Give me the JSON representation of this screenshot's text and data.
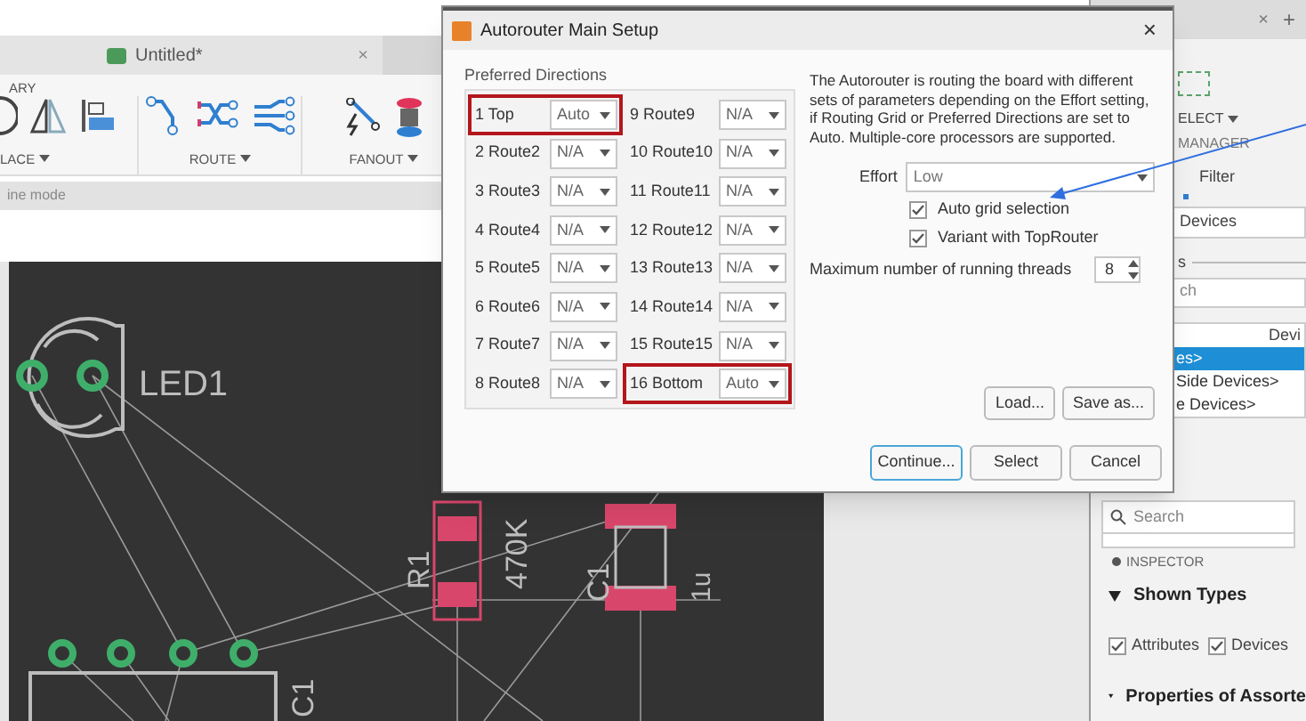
{
  "document_tab": {
    "title": "Untitled*",
    "close": "×"
  },
  "ribbon": {
    "top_label": "ARY",
    "groups": [
      {
        "label": "LACE",
        "kind": "place"
      },
      {
        "label": "ROUTE",
        "kind": "route"
      },
      {
        "label": "FANOUT",
        "kind": "fanout"
      }
    ]
  },
  "mode_bar": "ine mode",
  "canvas": {
    "labels": [
      {
        "text": "LED1",
        "kind": "led"
      },
      {
        "text": "R1",
        "kind": "r1"
      },
      {
        "text": "470K",
        "kind": "r1value"
      },
      {
        "text": "C1",
        "kind": "c1"
      },
      {
        "text": "1u",
        "kind": "c1value"
      },
      {
        "text": "C1",
        "kind": "lower"
      }
    ]
  },
  "dialog": {
    "title": "Autorouter Main Setup",
    "close": "×",
    "group_title": "Preferred Directions",
    "layers": [
      {
        "number": "1",
        "name": "Top",
        "direction": "Auto",
        "highlighted": true
      },
      {
        "number": "2",
        "name": "Route2",
        "direction": "N/A",
        "highlighted": false
      },
      {
        "number": "3",
        "name": "Route3",
        "direction": "N/A",
        "highlighted": false
      },
      {
        "number": "4",
        "name": "Route4",
        "direction": "N/A",
        "highlighted": false
      },
      {
        "number": "5",
        "name": "Route5",
        "direction": "N/A",
        "highlighted": false
      },
      {
        "number": "6",
        "name": "Route6",
        "direction": "N/A",
        "highlighted": false
      },
      {
        "number": "7",
        "name": "Route7",
        "direction": "N/A",
        "highlighted": false
      },
      {
        "number": "8",
        "name": "Route8",
        "direction": "N/A",
        "highlighted": false
      },
      {
        "number": "9",
        "name": "Route9",
        "direction": "N/A",
        "highlighted": false
      },
      {
        "number": "10",
        "name": "Route10",
        "direction": "N/A",
        "highlighted": false
      },
      {
        "number": "11",
        "name": "Route11",
        "direction": "N/A",
        "highlighted": false
      },
      {
        "number": "12",
        "name": "Route12",
        "direction": "N/A",
        "highlighted": false
      },
      {
        "number": "13",
        "name": "Route13",
        "direction": "N/A",
        "highlighted": false
      },
      {
        "number": "14",
        "name": "Route14",
        "direction": "N/A",
        "highlighted": false
      },
      {
        "number": "15",
        "name": "Route15",
        "direction": "N/A",
        "highlighted": false
      },
      {
        "number": "16",
        "name": "Bottom",
        "direction": "Auto",
        "highlighted": true
      }
    ],
    "description": "The Autorouter is routing the board with different sets of parameters depending on the Effort setting, if Routing Grid or Preferred Directions are set to Auto. Multiple-core processors are supported.",
    "effort_label": "Effort",
    "effort_value": "Low",
    "options": [
      {
        "label": "Auto grid selection",
        "checked": true
      },
      {
        "label": "Variant with TopRouter",
        "checked": true
      }
    ],
    "threads_label": "Maximum number of running threads",
    "threads_value": "8",
    "file_buttons": [
      "Load...",
      "Save as..."
    ],
    "footer_buttons": [
      {
        "label": "Continue...",
        "focused": true
      },
      {
        "label": "Select",
        "focused": false
      },
      {
        "label": "Cancel",
        "focused": false
      }
    ]
  },
  "right_panel": {
    "tab_close": "×",
    "tab_add": "+",
    "select_label": "ELECT",
    "manager_title": "MANAGER",
    "filter_label": "Filter",
    "devices_field": "Devices",
    "section_label": "s",
    "search_field": "ch",
    "list_header": "Devi",
    "list_items": [
      {
        "label": "es>",
        "selected": true
      },
      {
        "label": "Side Devices>",
        "selected": false
      },
      {
        "label": "e Devices>",
        "selected": false
      }
    ],
    "search_placeholder": "Search",
    "inspector_title": "INSPECTOR",
    "shown_types": {
      "title": "Shown Types",
      "expanded": true,
      "options": [
        {
          "label": "Attributes",
          "checked": true
        },
        {
          "label": "Devices",
          "checked": true
        }
      ]
    },
    "properties_title": "Properties of Assorte"
  }
}
